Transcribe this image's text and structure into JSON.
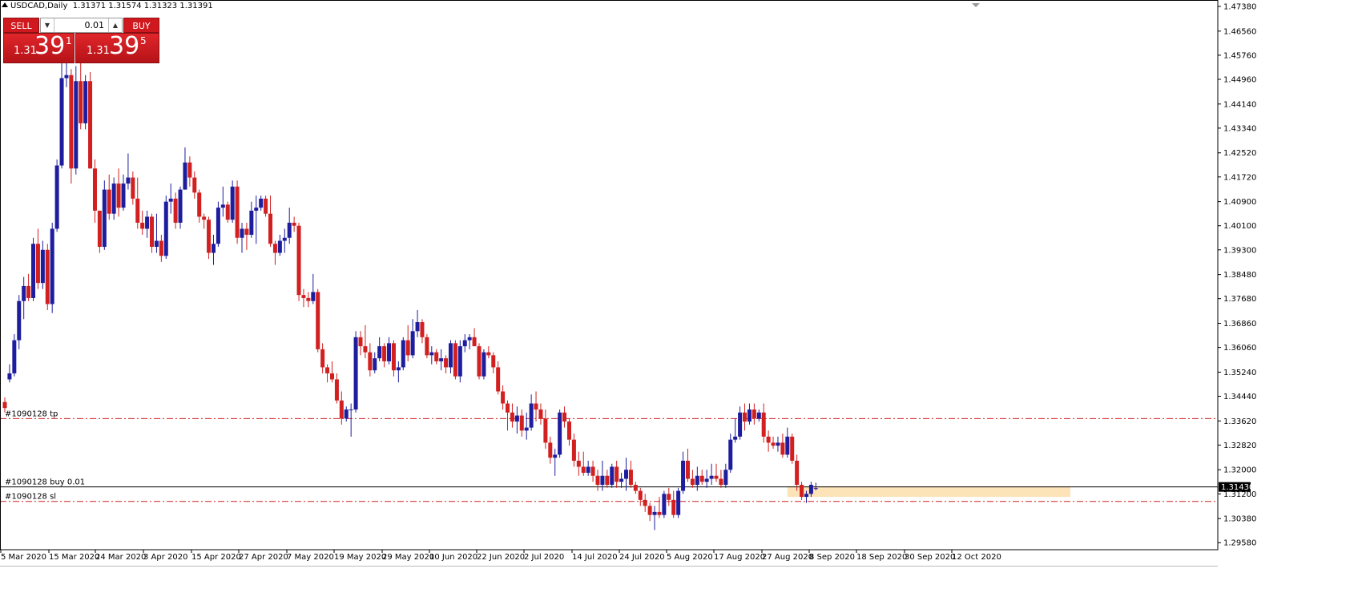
{
  "window": {
    "symbol": "USDCAD,Daily",
    "ohlc": "1.31371 1.31574 1.31323 1.31391"
  },
  "trade_panel": {
    "sell_label": "SELL",
    "buy_label": "BUY",
    "lot_value": "0.01",
    "sell_price": {
      "prefix": "1.31",
      "big": "39",
      "sup": "1"
    },
    "buy_price": {
      "prefix": "1.31",
      "big": "39",
      "sup": "5"
    }
  },
  "orders": {
    "tp_label": "#1090128 tp",
    "buy_label": "#1090128 buy 0.01",
    "sl_label": "#1090128 sl",
    "tp_price": 1.337,
    "entry_price": 1.3143,
    "sl_price": 1.3095
  },
  "current_price_label": "1.31430",
  "colors": {
    "bull": "#1d1d9e",
    "bear": "#d21f1f",
    "order_line": "#d02020",
    "zone": "#fde3b8",
    "price_tag_bg": "#000000"
  },
  "chart_data": {
    "type": "candlestick",
    "symbol": "USDCAD",
    "timeframe": "Daily",
    "ylim": [
      1.294,
      1.4738
    ],
    "y_ticks": [
      "1.47380",
      "1.46560",
      "1.45760",
      "1.44960",
      "1.44140",
      "1.43340",
      "1.42520",
      "1.41720",
      "1.40900",
      "1.40100",
      "1.39300",
      "1.38480",
      "1.37680",
      "1.36860",
      "1.36060",
      "1.35240",
      "1.34440",
      "1.33620",
      "1.32820",
      "1.32000",
      "1.31200",
      "1.30380",
      "1.29580"
    ],
    "x_labels": [
      "5 Mar 2020",
      "15 Mar 2020",
      "24 Mar 2020",
      "3 Apr 2020",
      "15 Apr 2020",
      "27 Apr 2020",
      "7 May 2020",
      "19 May 2020",
      "29 May 2020",
      "10 Jun 2020",
      "22 Jun 2020",
      "2 Jul 2020",
      "14 Jul 2020",
      "24 Jul 2020",
      "5 Aug 2020",
      "17 Aug 2020",
      "27 Aug 2020",
      "8 Sep 2020",
      "18 Sep 2020",
      "30 Sep 2020",
      "12 Oct 2020"
    ],
    "support_zone": [
      1.311,
      1.3145
    ],
    "candles": [
      [
        1.3425,
        1.344,
        1.339,
        1.3405
      ],
      [
        1.35,
        1.355,
        1.349,
        1.352
      ],
      [
        1.352,
        1.365,
        1.351,
        1.363
      ],
      [
        1.363,
        1.378,
        1.36,
        1.376
      ],
      [
        1.376,
        1.384,
        1.37,
        1.381
      ],
      [
        1.381,
        1.385,
        1.376,
        1.377
      ],
      [
        1.377,
        1.397,
        1.376,
        1.395
      ],
      [
        1.395,
        1.4,
        1.38,
        1.382
      ],
      [
        1.382,
        1.396,
        1.38,
        1.393
      ],
      [
        1.393,
        1.395,
        1.373,
        1.375
      ],
      [
        1.375,
        1.402,
        1.372,
        1.4
      ],
      [
        1.4,
        1.423,
        1.399,
        1.421
      ],
      [
        1.421,
        1.457,
        1.42,
        1.45
      ],
      [
        1.45,
        1.467,
        1.447,
        1.451
      ],
      [
        1.451,
        1.453,
        1.415,
        1.42
      ],
      [
        1.42,
        1.454,
        1.418,
        1.449
      ],
      [
        1.449,
        1.456,
        1.433,
        1.435
      ],
      [
        1.435,
        1.451,
        1.433,
        1.449
      ],
      [
        1.449,
        1.452,
        1.42,
        1.42
      ],
      [
        1.42,
        1.423,
        1.402,
        1.406
      ],
      [
        1.406,
        1.406,
        1.392,
        1.394
      ],
      [
        1.394,
        1.416,
        1.393,
        1.413
      ],
      [
        1.413,
        1.418,
        1.403,
        1.405
      ],
      [
        1.405,
        1.417,
        1.403,
        1.415
      ],
      [
        1.415,
        1.42,
        1.404,
        1.407
      ],
      [
        1.407,
        1.418,
        1.406,
        1.415
      ],
      [
        1.415,
        1.425,
        1.413,
        1.417
      ],
      [
        1.417,
        1.419,
        1.408,
        1.41
      ],
      [
        1.41,
        1.417,
        1.4,
        1.402
      ],
      [
        1.402,
        1.406,
        1.398,
        1.4
      ],
      [
        1.4,
        1.406,
        1.397,
        1.404
      ],
      [
        1.404,
        1.405,
        1.392,
        1.394
      ],
      [
        1.394,
        1.405,
        1.392,
        1.396
      ],
      [
        1.396,
        1.398,
        1.389,
        1.391
      ],
      [
        1.391,
        1.411,
        1.39,
        1.409
      ],
      [
        1.409,
        1.415,
        1.405,
        1.41
      ],
      [
        1.41,
        1.412,
        1.4,
        1.402
      ],
      [
        1.402,
        1.414,
        1.4,
        1.413
      ],
      [
        1.413,
        1.427,
        1.413,
        1.422
      ],
      [
        1.422,
        1.424,
        1.414,
        1.417
      ],
      [
        1.417,
        1.419,
        1.41,
        1.412
      ],
      [
        1.412,
        1.413,
        1.402,
        1.404
      ],
      [
        1.404,
        1.405,
        1.4,
        1.403
      ],
      [
        1.403,
        1.404,
        1.39,
        1.392
      ],
      [
        1.392,
        1.398,
        1.388,
        1.395
      ],
      [
        1.395,
        1.409,
        1.394,
        1.407
      ],
      [
        1.407,
        1.414,
        1.404,
        1.408
      ],
      [
        1.408,
        1.409,
        1.402,
        1.403
      ],
      [
        1.403,
        1.416,
        1.402,
        1.414
      ],
      [
        1.414,
        1.416,
        1.395,
        1.397
      ],
      [
        1.397,
        1.402,
        1.392,
        1.4
      ],
      [
        1.4,
        1.402,
        1.393,
        1.398
      ],
      [
        1.398,
        1.409,
        1.397,
        1.406
      ],
      [
        1.406,
        1.411,
        1.395,
        1.407
      ],
      [
        1.407,
        1.411,
        1.406,
        1.41
      ],
      [
        1.41,
        1.411,
        1.404,
        1.405
      ],
      [
        1.405,
        1.411,
        1.394,
        1.395
      ],
      [
        1.395,
        1.396,
        1.388,
        1.392
      ],
      [
        1.392,
        1.398,
        1.391,
        1.396
      ],
      [
        1.396,
        1.4,
        1.392,
        1.397
      ],
      [
        1.397,
        1.407,
        1.395,
        1.402
      ],
      [
        1.402,
        1.404,
        1.399,
        1.401
      ],
      [
        1.401,
        1.402,
        1.376,
        1.378
      ],
      [
        1.378,
        1.38,
        1.374,
        1.377
      ],
      [
        1.377,
        1.379,
        1.374,
        1.376
      ],
      [
        1.376,
        1.385,
        1.375,
        1.379
      ],
      [
        1.379,
        1.38,
        1.359,
        1.36
      ],
      [
        1.36,
        1.362,
        1.352,
        1.354
      ],
      [
        1.354,
        1.355,
        1.349,
        1.352
      ],
      [
        1.352,
        1.356,
        1.349,
        1.35
      ],
      [
        1.35,
        1.352,
        1.342,
        1.343
      ],
      [
        1.343,
        1.346,
        1.335,
        1.337
      ],
      [
        1.337,
        1.341,
        1.336,
        1.34
      ],
      [
        1.34,
        1.342,
        1.331,
        1.34
      ],
      [
        1.34,
        1.366,
        1.339,
        1.364
      ],
      [
        1.364,
        1.366,
        1.358,
        1.361
      ],
      [
        1.361,
        1.368,
        1.357,
        1.359
      ],
      [
        1.359,
        1.362,
        1.351,
        1.353
      ],
      [
        1.353,
        1.359,
        1.352,
        1.357
      ],
      [
        1.357,
        1.364,
        1.356,
        1.361
      ],
      [
        1.361,
        1.362,
        1.354,
        1.356
      ],
      [
        1.356,
        1.364,
        1.355,
        1.362
      ],
      [
        1.362,
        1.363,
        1.351,
        1.353
      ],
      [
        1.353,
        1.356,
        1.349,
        1.354
      ],
      [
        1.354,
        1.364,
        1.353,
        1.363
      ],
      [
        1.363,
        1.368,
        1.356,
        1.358
      ],
      [
        1.358,
        1.37,
        1.357,
        1.366
      ],
      [
        1.366,
        1.373,
        1.364,
        1.369
      ],
      [
        1.369,
        1.37,
        1.362,
        1.364
      ],
      [
        1.364,
        1.365,
        1.357,
        1.358
      ],
      [
        1.358,
        1.361,
        1.355,
        1.359
      ],
      [
        1.359,
        1.36,
        1.355,
        1.356
      ],
      [
        1.356,
        1.36,
        1.353,
        1.357
      ],
      [
        1.357,
        1.358,
        1.352,
        1.354
      ],
      [
        1.354,
        1.363,
        1.352,
        1.362
      ],
      [
        1.362,
        1.363,
        1.35,
        1.351
      ],
      [
        1.351,
        1.363,
        1.349,
        1.361
      ],
      [
        1.361,
        1.365,
        1.359,
        1.363
      ],
      [
        1.363,
        1.365,
        1.36,
        1.364
      ],
      [
        1.364,
        1.367,
        1.361,
        1.361
      ],
      [
        1.361,
        1.362,
        1.35,
        1.351
      ],
      [
        1.351,
        1.36,
        1.35,
        1.359
      ],
      [
        1.359,
        1.361,
        1.357,
        1.358
      ],
      [
        1.358,
        1.359,
        1.352,
        1.354
      ],
      [
        1.354,
        1.356,
        1.345,
        1.346
      ],
      [
        1.346,
        1.348,
        1.34,
        1.342
      ],
      [
        1.342,
        1.343,
        1.333,
        1.339
      ],
      [
        1.339,
        1.342,
        1.334,
        1.336
      ],
      [
        1.336,
        1.341,
        1.332,
        1.338
      ],
      [
        1.338,
        1.34,
        1.331,
        1.333
      ],
      [
        1.333,
        1.339,
        1.33,
        1.334
      ],
      [
        1.334,
        1.345,
        1.333,
        1.342
      ],
      [
        1.342,
        1.346,
        1.336,
        1.34
      ],
      [
        1.34,
        1.342,
        1.335,
        1.337
      ],
      [
        1.337,
        1.34,
        1.327,
        1.329
      ],
      [
        1.329,
        1.331,
        1.322,
        1.324
      ],
      [
        1.324,
        1.327,
        1.318,
        1.325
      ],
      [
        1.325,
        1.34,
        1.324,
        1.339
      ],
      [
        1.339,
        1.341,
        1.334,
        1.336
      ],
      [
        1.336,
        1.337,
        1.328,
        1.33
      ],
      [
        1.33,
        1.332,
        1.321,
        1.323
      ],
      [
        1.323,
        1.326,
        1.318,
        1.321
      ],
      [
        1.321,
        1.326,
        1.318,
        1.319
      ],
      [
        1.319,
        1.323,
        1.318,
        1.321
      ],
      [
        1.321,
        1.323,
        1.316,
        1.318
      ],
      [
        1.318,
        1.32,
        1.313,
        1.315
      ],
      [
        1.315,
        1.323,
        1.313,
        1.318
      ],
      [
        1.318,
        1.32,
        1.314,
        1.315
      ],
      [
        1.315,
        1.322,
        1.314,
        1.321
      ],
      [
        1.321,
        1.323,
        1.314,
        1.316
      ],
      [
        1.316,
        1.319,
        1.314,
        1.317
      ],
      [
        1.317,
        1.324,
        1.313,
        1.32
      ],
      [
        1.32,
        1.323,
        1.314,
        1.315
      ],
      [
        1.315,
        1.316,
        1.312,
        1.313
      ],
      [
        1.313,
        1.314,
        1.308,
        1.31
      ],
      [
        1.31,
        1.312,
        1.306,
        1.308
      ],
      [
        1.308,
        1.309,
        1.303,
        1.305
      ],
      [
        1.305,
        1.308,
        1.3,
        1.306
      ],
      [
        1.306,
        1.311,
        1.304,
        1.305
      ],
      [
        1.305,
        1.313,
        1.304,
        1.312
      ],
      [
        1.312,
        1.314,
        1.308,
        1.31
      ],
      [
        1.31,
        1.313,
        1.304,
        1.305
      ],
      [
        1.305,
        1.314,
        1.304,
        1.313
      ],
      [
        1.313,
        1.326,
        1.312,
        1.323
      ],
      [
        1.323,
        1.327,
        1.316,
        1.317
      ],
      [
        1.317,
        1.32,
        1.314,
        1.315
      ],
      [
        1.315,
        1.321,
        1.313,
        1.318
      ],
      [
        1.318,
        1.32,
        1.315,
        1.316
      ],
      [
        1.316,
        1.32,
        1.314,
        1.317
      ],
      [
        1.317,
        1.322,
        1.315,
        1.318
      ],
      [
        1.318,
        1.322,
        1.316,
        1.317
      ],
      [
        1.317,
        1.32,
        1.314,
        1.315
      ],
      [
        1.315,
        1.322,
        1.314,
        1.32
      ],
      [
        1.32,
        1.332,
        1.319,
        1.33
      ],
      [
        1.33,
        1.337,
        1.329,
        1.331
      ],
      [
        1.331,
        1.341,
        1.33,
        1.339
      ],
      [
        1.339,
        1.342,
        1.333,
        1.336
      ],
      [
        1.336,
        1.342,
        1.335,
        1.34
      ],
      [
        1.34,
        1.342,
        1.335,
        1.337
      ],
      [
        1.337,
        1.34,
        1.336,
        1.339
      ],
      [
        1.339,
        1.342,
        1.329,
        1.331
      ],
      [
        1.331,
        1.333,
        1.326,
        1.329
      ],
      [
        1.329,
        1.331,
        1.327,
        1.328
      ],
      [
        1.328,
        1.331,
        1.326,
        1.329
      ],
      [
        1.329,
        1.332,
        1.324,
        1.325
      ],
      [
        1.325,
        1.334,
        1.324,
        1.331
      ],
      [
        1.331,
        1.332,
        1.322,
        1.323
      ],
      [
        1.323,
        1.325,
        1.313,
        1.315
      ],
      [
        1.315,
        1.316,
        1.31,
        1.311
      ],
      [
        1.311,
        1.313,
        1.309,
        1.312
      ],
      [
        1.312,
        1.316,
        1.311,
        1.315
      ],
      [
        1.3137,
        1.3157,
        1.3132,
        1.3139
      ]
    ]
  }
}
